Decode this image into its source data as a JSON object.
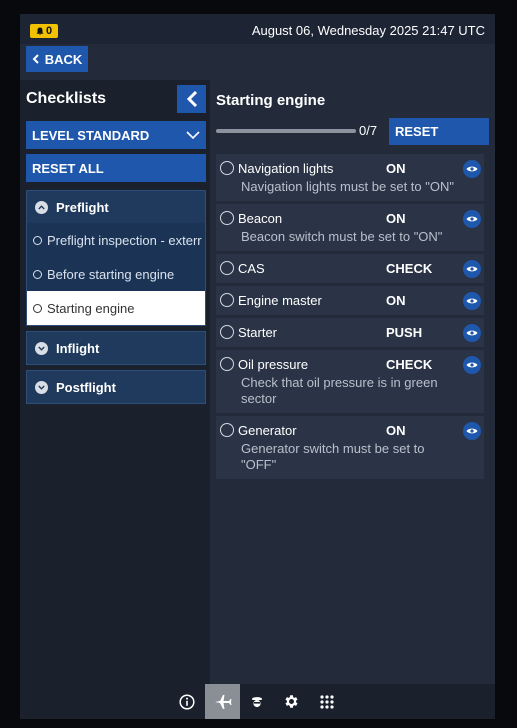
{
  "status": {
    "notification_count": "0",
    "datetime": "August 06, Wednesday 2025 21:47 UTC",
    "notification_color": "#f2c200"
  },
  "nav": {
    "back_label": "BACK"
  },
  "left_panel": {
    "title": "Checklists",
    "level_label": "LEVEL STANDARD",
    "reset_all_label": "RESET ALL",
    "sections": [
      {
        "label": "Preflight",
        "expanded": true,
        "items": [
          {
            "label": "Preflight inspection - exterr",
            "active": false
          },
          {
            "label": "Before starting engine",
            "active": false
          },
          {
            "label": "Starting engine",
            "active": true
          }
        ]
      },
      {
        "label": "Inflight",
        "expanded": false,
        "items": []
      },
      {
        "label": "Postflight",
        "expanded": false,
        "items": []
      }
    ]
  },
  "checklist": {
    "title": "Starting engine",
    "progress_text": "0/7",
    "progress_fraction": 0,
    "reset_label": "RESET",
    "items": [
      {
        "name": "Navigation lights",
        "value": "ON",
        "desc": "Navigation lights must be set to \"ON\""
      },
      {
        "name": "Beacon",
        "value": "ON",
        "desc": "Beacon switch must be set to \"ON\""
      },
      {
        "name": "CAS",
        "value": "CHECK",
        "desc": ""
      },
      {
        "name": "Engine master",
        "value": "ON",
        "desc": ""
      },
      {
        "name": "Starter",
        "value": "PUSH",
        "desc": ""
      },
      {
        "name": "Oil pressure",
        "value": "CHECK",
        "desc": "Check that oil pressure is in green sector"
      },
      {
        "name": "Generator",
        "value": "ON",
        "desc": "Generator switch must be set to \"OFF\""
      }
    ]
  },
  "bottom_nav": [
    {
      "icon": "info-icon",
      "active": false
    },
    {
      "icon": "airplane-icon",
      "active": true
    },
    {
      "icon": "pilot-icon",
      "active": false
    },
    {
      "icon": "gear-icon",
      "active": false
    },
    {
      "icon": "grid-icon",
      "active": false
    }
  ],
  "colors": {
    "accent": "#1f57ad",
    "panel_bg": "#232b3b",
    "item_bg": "#2b3446"
  }
}
